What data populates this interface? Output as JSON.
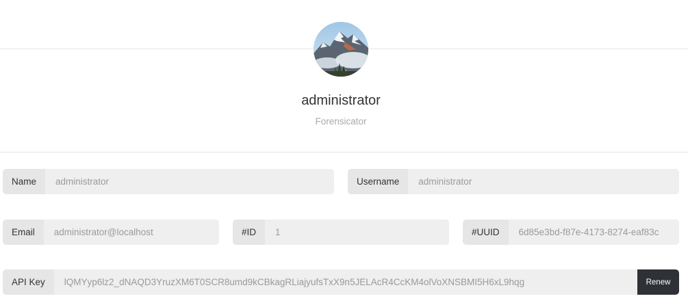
{
  "profile": {
    "avatar_icon": "mountain-landscape-avatar",
    "name": "administrator",
    "role": "Forensicator"
  },
  "fields": {
    "name": {
      "label": "Name",
      "value": "administrator"
    },
    "username": {
      "label": "Username",
      "value": "administrator"
    },
    "email": {
      "label": "Email",
      "value": "administrator@localhost"
    },
    "id": {
      "label": "#ID",
      "value": "1"
    },
    "uuid": {
      "label": "#UUID",
      "value": "6d85e3bd-f87e-4173-8274-eaf83c"
    },
    "api_key": {
      "label": "API Key",
      "value": "lQMYyp6lz2_dNAQD3YruzXM6T0SCR8umd9kCBkagRLiajyufsTxX9n5JELAcR4CcKM4olVoXNSBMI5H6xL9hqg",
      "renew_label": "Renew"
    }
  },
  "colors": {
    "field_bg": "#efefef",
    "label_bg": "#e6e6e6",
    "renew_bg": "#2e3135",
    "muted_text": "#a9a9a9"
  }
}
